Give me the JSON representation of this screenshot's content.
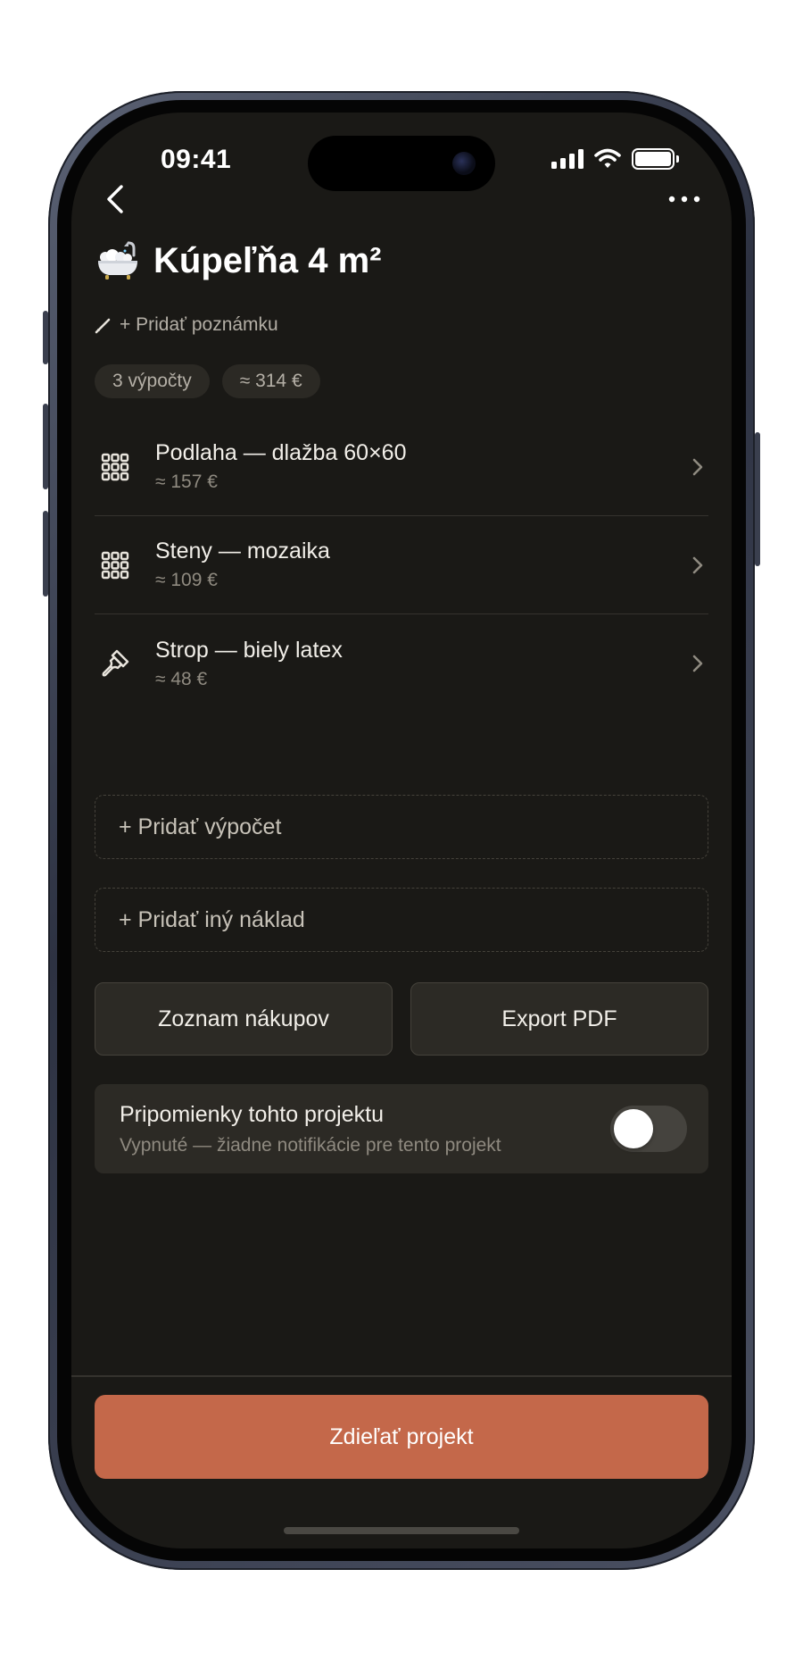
{
  "status_bar": {
    "time": "09:41",
    "icons": [
      "cellular-signal-icon",
      "wifi-icon",
      "battery-icon"
    ]
  },
  "nav": {
    "back_icon": "chevron-left-icon",
    "more_icon": "ellipsis-icon"
  },
  "project": {
    "emoji": "bathtub-icon",
    "title": "Kúpeľňa 4 m²",
    "note_icon": "pencil-icon",
    "add_note_label": "+ Pridať poznámku"
  },
  "chips": {
    "count": "3 výpočty",
    "total": "≈ 314 €"
  },
  "calculations": [
    {
      "icon": "tiles-grid-icon",
      "name": "Podlaha — dlažba 60×60",
      "price": "≈ 157 €"
    },
    {
      "icon": "tiles-grid-icon",
      "name": "Steny — mozaika",
      "price": "≈ 109 €"
    },
    {
      "icon": "paint-brush-icon",
      "name": "Strop — biely latex",
      "price": "≈ 48 €"
    }
  ],
  "add_actions": {
    "add_calculation": "+ Pridať výpočet",
    "add_other_cost": "+ Pridať iný náklad"
  },
  "actions": {
    "shopping_list": "Zoznam nákupov",
    "export_pdf": "Export PDF"
  },
  "reminders": {
    "title": "Pripomienky tohto projektu",
    "subtitle": "Vypnuté — žiadne notifikácie pre tento projekt",
    "enabled": false
  },
  "share": {
    "label": "Zdieľať projekt"
  },
  "colors": {
    "background": "#1a1916",
    "card": "#2c2a25",
    "accent": "#c4684a",
    "text_primary": "#f2efe9",
    "text_secondary": "#8f8a80"
  }
}
